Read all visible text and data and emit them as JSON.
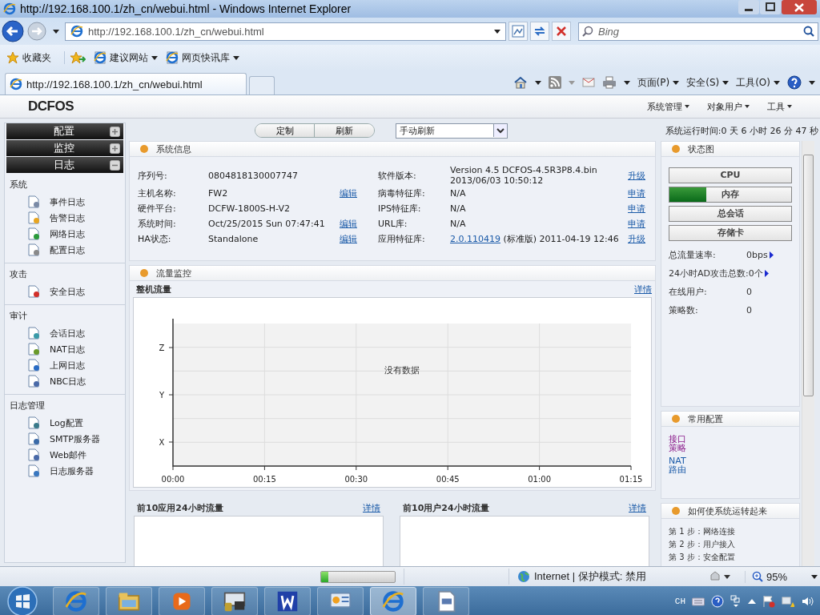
{
  "browser": {
    "title": "http://192.168.100.1/zh_cn/webui.html - Windows Internet Explorer",
    "address": "http://192.168.100.1/zh_cn/webui.html",
    "search_placeholder": "Bing",
    "favorites_label": "收藏夹",
    "favorites": [
      "建议网站",
      "网页快讯库"
    ],
    "tabs": [
      {
        "label": "http://192.168.100.1/zh_cn/webui.html",
        "selected": true
      }
    ],
    "commands": [
      "页面(P)",
      "安全(S)",
      "工具(O)"
    ]
  },
  "app": {
    "logo": "DCFOS",
    "menu": [
      "系统管理",
      "对象用户",
      "工具"
    ]
  },
  "sidebar": {
    "sections": [
      {
        "label": "配置",
        "expanded": false
      },
      {
        "label": "监控",
        "expanded": false
      },
      {
        "label": "日志",
        "expanded": true
      }
    ],
    "groups": [
      {
        "title": "系统",
        "items": [
          "事件日志",
          "告警日志",
          "网络日志",
          "配置日志"
        ]
      },
      {
        "title": "攻击",
        "items": [
          "安全日志"
        ]
      },
      {
        "title": "审计",
        "items": [
          "会话日志",
          "NAT日志",
          "上网日志",
          "NBC日志"
        ]
      },
      {
        "title": "日志管理",
        "items": [
          "Log配置",
          "SMTP服务器",
          "Web邮件",
          "日志服务器"
        ]
      }
    ]
  },
  "toolbar": {
    "buttons": [
      "定制",
      "刷新"
    ],
    "refresh_mode": "手动刷新",
    "uptime": "系统运行时间:0 天 6 小时 26 分 47 秒"
  },
  "system_info": {
    "title": "系统信息",
    "left": [
      {
        "label": "序列号:",
        "value": "0804818130007747"
      },
      {
        "label": "主机名称:",
        "value": "FW2",
        "action": "编辑"
      },
      {
        "label": "硬件平台:",
        "value": "DCFW-1800S-H-V2"
      },
      {
        "label": "系统时间:",
        "value": "Oct/25/2015  Sun  07:47:41",
        "action": "编辑"
      },
      {
        "label": "HA状态:",
        "value": "Standalone",
        "action": "编辑"
      }
    ],
    "right": [
      {
        "label": "软件版本:",
        "value": "Version 4.5 DCFOS-4.5R3P8.4.bin",
        "value_line_2": "2013/06/03 10:50:12",
        "action": "升级"
      },
      {
        "label": "病毒特征库:",
        "value": "N/A",
        "action": "申请"
      },
      {
        "label": "IPS特征库:",
        "value": "N/A",
        "action": "申请"
      },
      {
        "label": "URL库:",
        "value": "N/A",
        "action": "申请"
      },
      {
        "label": "应用特征库:",
        "value_link": "2.0.110419",
        "value": "(标准版) 2011-04-19 12:46",
        "action": "升级"
      }
    ]
  },
  "traffic": {
    "title": "流量监控",
    "chart_title": "整机流量",
    "link": "详情",
    "chart": {
      "y_labels": [
        "Z",
        "Y",
        "X"
      ],
      "x_labels": [
        "00:00",
        "00:15",
        "00:30",
        "00:45",
        "01:00",
        "01:15"
      ],
      "message": "没有数据"
    },
    "panels": [
      {
        "title": "前10应用24小时流量",
        "link": "详情"
      },
      {
        "title": "前10用户24小时流量",
        "link": "详情"
      }
    ]
  },
  "status": {
    "title": "状态图",
    "meters": [
      {
        "label": "CPU",
        "level": 0
      },
      {
        "label": "内存",
        "level": 0.3
      },
      {
        "label": "总会话",
        "level": 0
      },
      {
        "label": "存储卡",
        "level": 0
      }
    ],
    "stats": [
      {
        "label": "总流量速率:",
        "value": "0bps",
        "more": true
      },
      {
        "label": "24小时AD攻击总数:",
        "value": "0个",
        "more": true
      },
      {
        "label": "在线用户:",
        "value": "0",
        "more": false
      },
      {
        "label": "策略数:",
        "value": "0",
        "more": false
      }
    ]
  },
  "common_config": {
    "title": "常用配置",
    "links": [
      {
        "label": "接口",
        "visited": true
      },
      {
        "label": "策略",
        "visited": true
      },
      {
        "label": "NAT",
        "visited": false
      },
      {
        "label": "路由",
        "visited": false
      }
    ]
  },
  "howto": {
    "title": "如何使系统运转起来",
    "steps": [
      "第 1 步：网络连接",
      "第 2 步：用户接入",
      "第 3 步：安全配置"
    ]
  },
  "status_bar": {
    "progress": {
      "level": 0.1
    },
    "zone": "Internet | 保护模式: 禁用",
    "zoom": "95%"
  },
  "taskbar": {
    "apps": [
      {
        "selected": false
      },
      {
        "selected": false
      },
      {
        "selected": false
      },
      {
        "selected": false
      },
      {
        "selected": false
      },
      {
        "selected": false
      },
      {
        "selected": true
      },
      {
        "selected": false
      }
    ],
    "language": "CH"
  }
}
